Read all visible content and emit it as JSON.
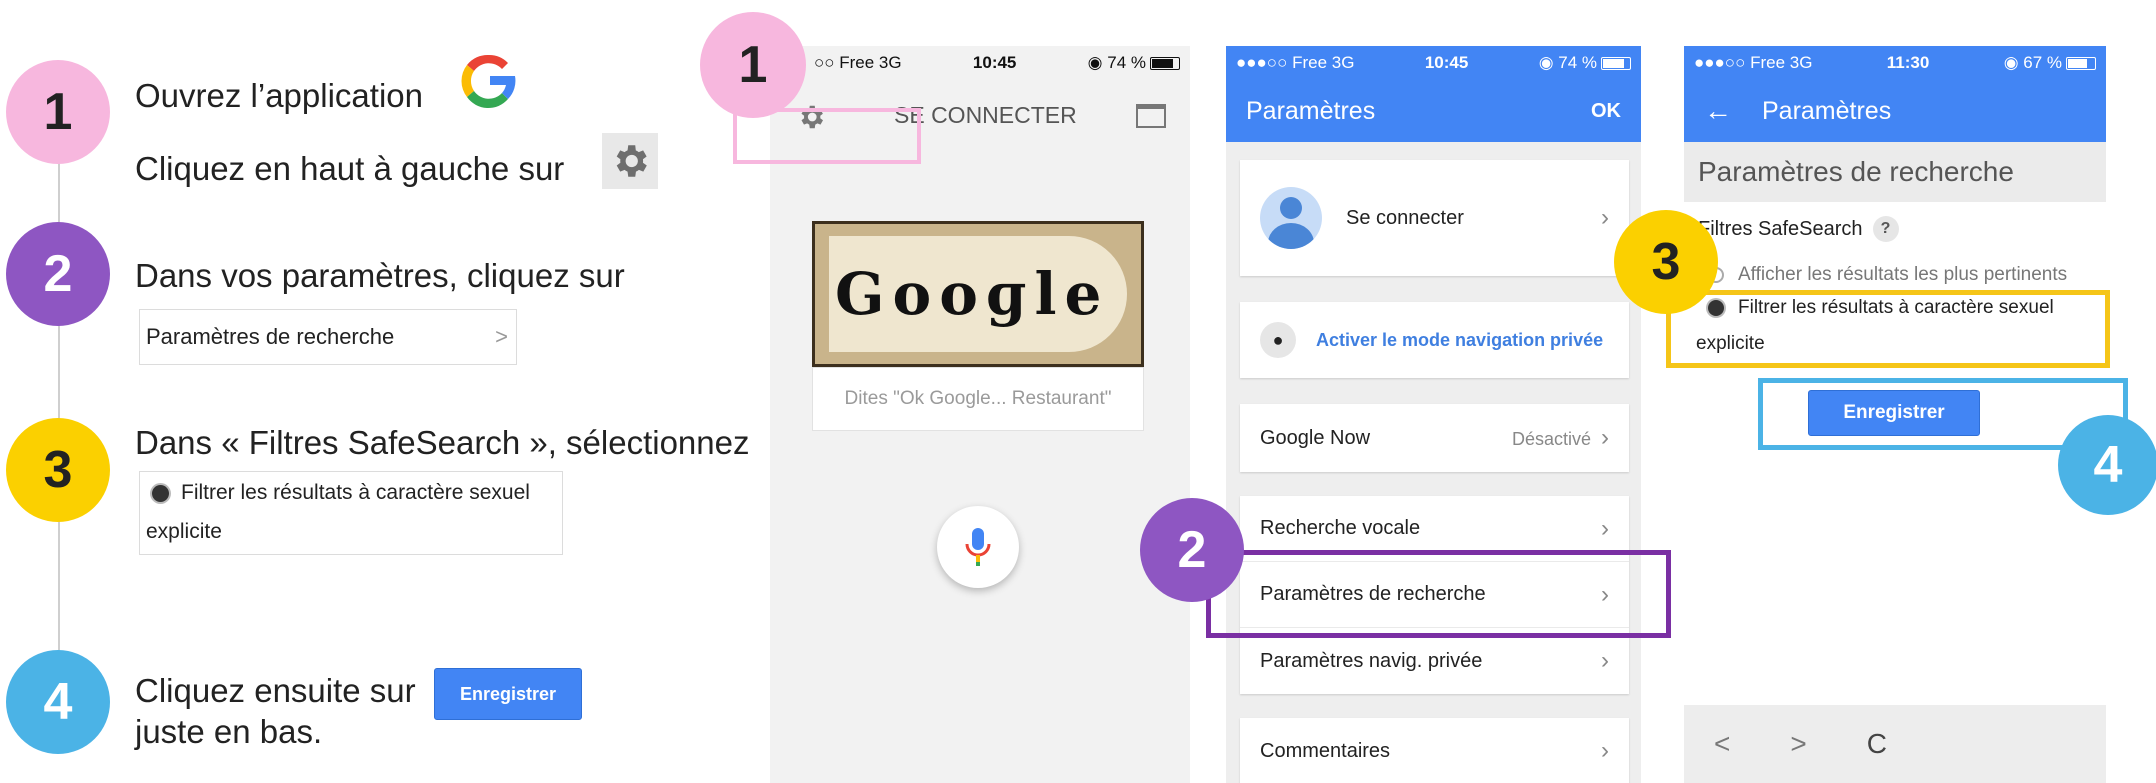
{
  "colors": {
    "pink": "#f7b7de",
    "purple": "#8e56c2",
    "yellow": "#fbd000",
    "light_blue": "#4bb3e6",
    "google_blue": "#4285f4",
    "box_purple": "#7a2fa3",
    "box_yellow": "#f5c518",
    "box_blue": "#4bb3e6"
  },
  "steps": [
    {
      "number": "1",
      "lines": [
        "Ouvrez l’application",
        "Cliquez en haut à gauche sur"
      ],
      "icons": [
        "google-g-icon",
        "gear-icon"
      ]
    },
    {
      "number": "2",
      "text": "Dans vos paramètres, cliquez sur",
      "card_label": "Paramètres de recherche",
      "card_chevron": ">"
    },
    {
      "number": "3",
      "text": "Dans « Filtres SafeSearch », sélectionnez",
      "card_line1": "Filtrer les résultats à caractère sexuel",
      "card_line2": "explicite"
    },
    {
      "number": "4",
      "text_before": "Cliquez ensuite sur",
      "button_label": "Enregistrer",
      "text_after": "juste en bas."
    }
  ],
  "phone1": {
    "status": {
      "carrier": "○○ Free  3G",
      "time": "10:45",
      "battery": "74 %",
      "battery_level": 0.74
    },
    "signin_label": "SE CONNECTER",
    "doodle_text": "Gooɡle",
    "search_hint": "Dites \"Ok Google... Restaurant\"",
    "callout_number": "1"
  },
  "phone2": {
    "status": {
      "carrier": "●●●○○ Free  3G",
      "time": "10:45",
      "battery": "74 %",
      "battery_level": 0.74
    },
    "title": "Paramètres",
    "ok": "OK",
    "signin": "Se connecter",
    "private_mode": "Activer le mode navigation privée",
    "google_now": "Google Now",
    "google_now_value": "Désactivé",
    "voice_search": "Recherche vocale",
    "search_settings": "Paramètres de recherche",
    "private_settings": "Paramètres navig. privée",
    "comments": "Commentaires",
    "callout_number": "2"
  },
  "phone3": {
    "status": {
      "carrier": "●●●○○ Free  3G",
      "time": "11:30",
      "battery": "67 %",
      "battery_level": 0.67
    },
    "back": "←",
    "title": "Paramètres",
    "section_title": "Paramètres de recherche",
    "safesearch_label": "Filtres SafeSearch",
    "help": "?",
    "option1": "Afficher les résultats les plus pertinents",
    "option2_line1": "Filtrer les résultats à caractère sexuel",
    "option2_line2": "explicite",
    "save": "Enregistrer",
    "nav_back": "<",
    "nav_forward": ">",
    "nav_reload": "C",
    "callout3": "3",
    "callout4": "4"
  }
}
